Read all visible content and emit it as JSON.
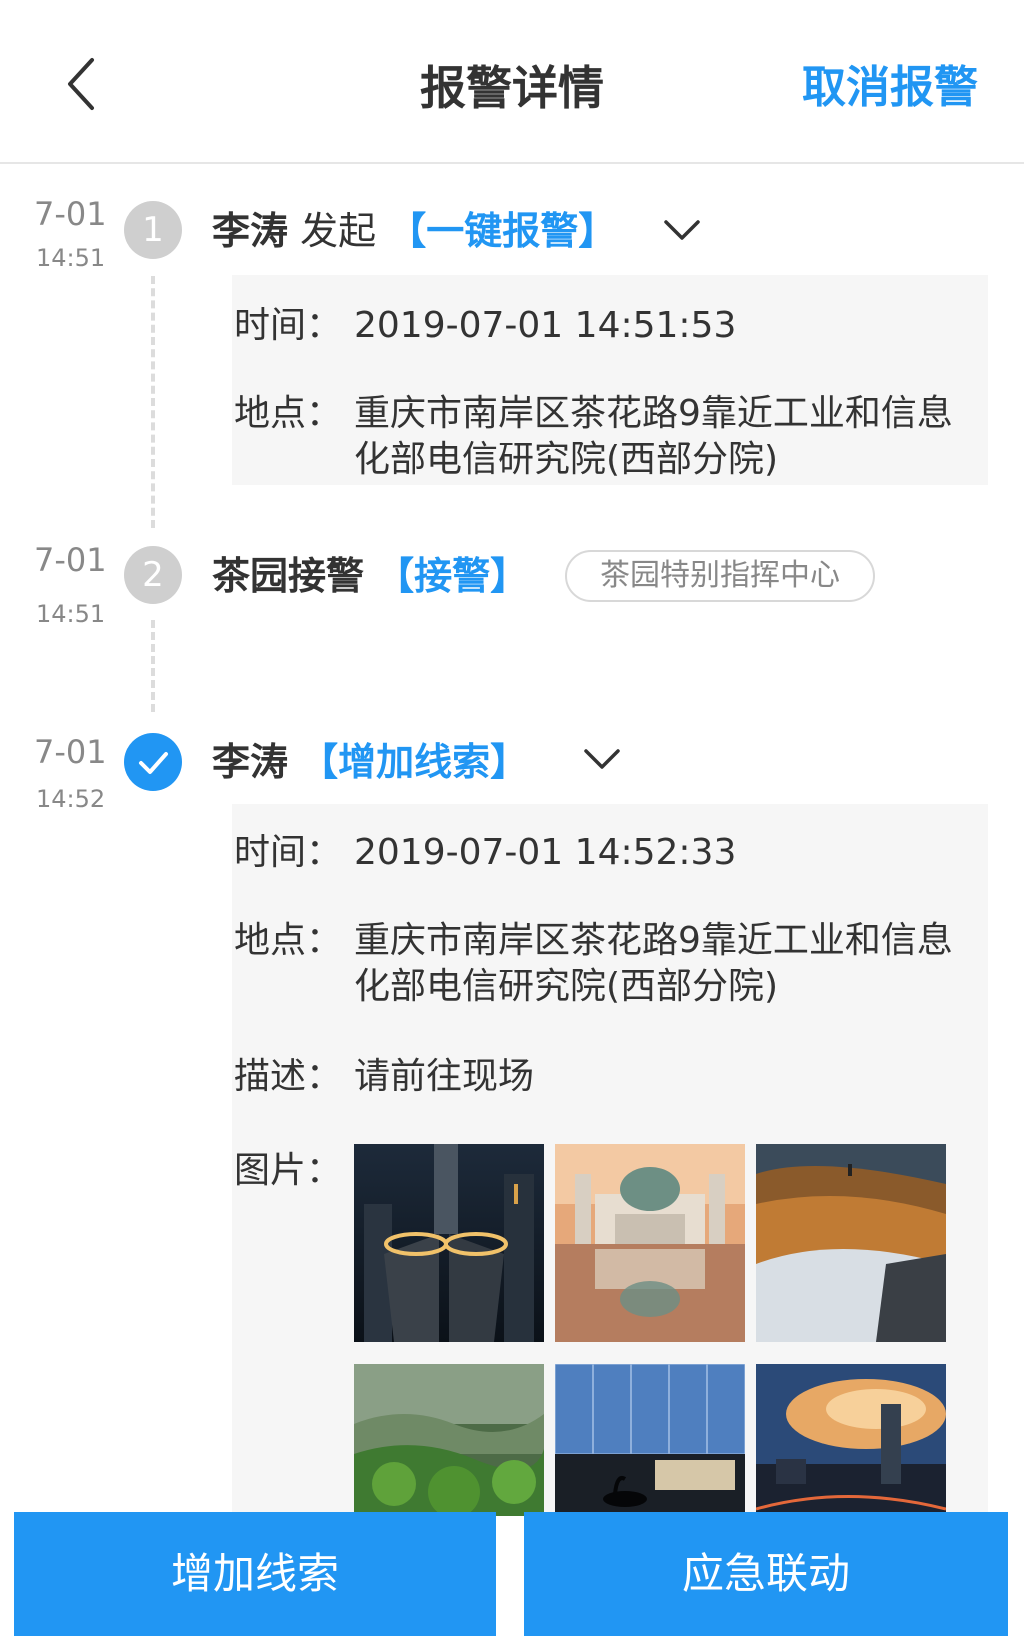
{
  "header": {
    "title": "报警详情",
    "cancel_label": "取消报警"
  },
  "timeline": [
    {
      "date": "7-01",
      "time": "14:51",
      "step": "1",
      "name": "李涛",
      "verb": "发起",
      "action": "【一键报警】",
      "details": {
        "time_label": "时间：",
        "time_value": "2019-07-01 14:51:53",
        "place_label": "地点：",
        "place_value": "重庆市南岸区茶花路9靠近工业和信息化部电信研究院(西部分院)"
      }
    },
    {
      "date": "7-01",
      "time": "14:51",
      "step": "2",
      "name": "茶园接警",
      "action": "【接警】",
      "tag": "茶园特别指挥中心"
    },
    {
      "date": "7-01",
      "time": "14:52",
      "status": "completed",
      "name": "李涛",
      "action": "【增加线索】",
      "details": {
        "time_label": "时间：",
        "time_value": "2019-07-01 14:52:33",
        "place_label": "地点：",
        "place_value": "重庆市南岸区茶花路9靠近工业和信息化部电信研究院(西部分院)",
        "desc_label": "描述：",
        "desc_value": "请前往现场",
        "images_label": "图片：",
        "images": [
          "city-skyscrapers-night",
          "church-reflection",
          "mountain-snow-sunset",
          "green-forest-hills",
          "glass-building-swans",
          "city-skyline-sunset"
        ]
      }
    }
  ],
  "bottom": {
    "add_clue_label": "增加线索",
    "emergency_label": "应急联动"
  },
  "colors": {
    "accent": "#2196f3",
    "inactive_dot": "#cfcfcf",
    "detail_bg": "#f6f6f6"
  }
}
